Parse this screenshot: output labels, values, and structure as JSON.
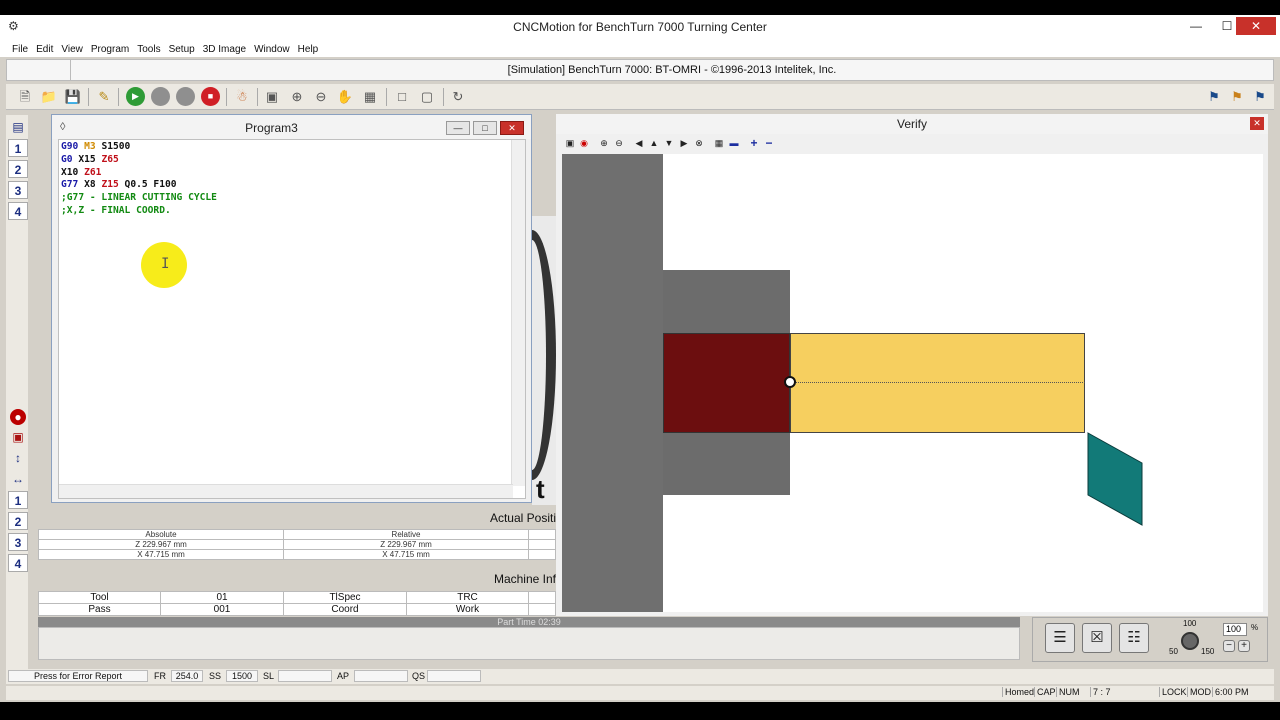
{
  "window": {
    "title": "CNCMotion for BenchTurn 7000 Turning Center",
    "minimize": "—",
    "maximize": "☐",
    "close": "✕"
  },
  "menu": [
    "File",
    "Edit",
    "View",
    "Program",
    "Tools",
    "Setup",
    "3D Image",
    "Window",
    "Help"
  ],
  "status_line": "[Simulation] BenchTurn 7000: BT-OMRI - ©1996-2013 Intelitek, Inc.",
  "left_toolbar": {
    "top_numbers": [
      "1",
      "2",
      "3",
      "4"
    ],
    "bottom_numbers": [
      "1",
      "2",
      "3",
      "4"
    ]
  },
  "program": {
    "title": "Program3",
    "lines": [
      [
        {
          "t": "G90 ",
          "c": "blue"
        },
        {
          "t": "M3 ",
          "c": "orange"
        },
        {
          "t": "S1500",
          "c": "black"
        }
      ],
      [
        {
          "t": "G0 ",
          "c": "blue"
        },
        {
          "t": "X15 ",
          "c": "black"
        },
        {
          "t": "Z65",
          "c": "red"
        }
      ],
      [
        {
          "t": "X10 ",
          "c": "black"
        },
        {
          "t": "Z61",
          "c": "red"
        }
      ],
      [
        {
          "t": "G77 ",
          "c": "blue"
        },
        {
          "t": "X8 ",
          "c": "black"
        },
        {
          "t": "Z15 ",
          "c": "red"
        },
        {
          "t": "Q0.5 F100",
          "c": "black"
        }
      ],
      [
        {
          "t": ";G77 - LINEAR CUTTING CYCLE",
          "c": "green"
        }
      ],
      [
        {
          "t": ";X,Z - FINAL COORD.",
          "c": "green"
        }
      ]
    ]
  },
  "verify": {
    "title": "Verify"
  },
  "actual_position": {
    "title": "Actual Positi",
    "headers": [
      "Absolute",
      "Relative"
    ],
    "rows": [
      [
        "Z 229.967 mm",
        "Z 229.967 mm"
      ],
      [
        "X  47.715 mm",
        "X  47.715 mm"
      ]
    ]
  },
  "machine_info": {
    "title": "Machine Inf",
    "rows": [
      [
        "Tool",
        "01",
        "TlSpec",
        "TRC"
      ],
      [
        "Pass",
        "001",
        "Coord",
        "Work"
      ]
    ]
  },
  "part_time": "Part Time 02:39",
  "feed_override": {
    "max_label": "100",
    "low_label": "50",
    "high_label": "150",
    "value": "100",
    "unit": "%"
  },
  "status_bar": {
    "error_report": "Press for Error Report",
    "fr_label": "FR",
    "fr_value": "254.0",
    "ss_label": "SS",
    "ss_value": "1500",
    "sl_label": "SL",
    "ap_label": "AP",
    "qs_label": "QS"
  },
  "bottom_bar": {
    "homed": "Homed",
    "cap": "CAP",
    "num": "NUM",
    "pos": "7 :    7",
    "lock": "LOCK",
    "mod": "MOD",
    "time": "6:00 PM"
  },
  "colors": {
    "stock": "#f6cf5f",
    "cut_region": "#6c0e0f",
    "chuck": "#6f6f6f",
    "tool": "#127a78",
    "highlight": "#f7ec1a"
  }
}
